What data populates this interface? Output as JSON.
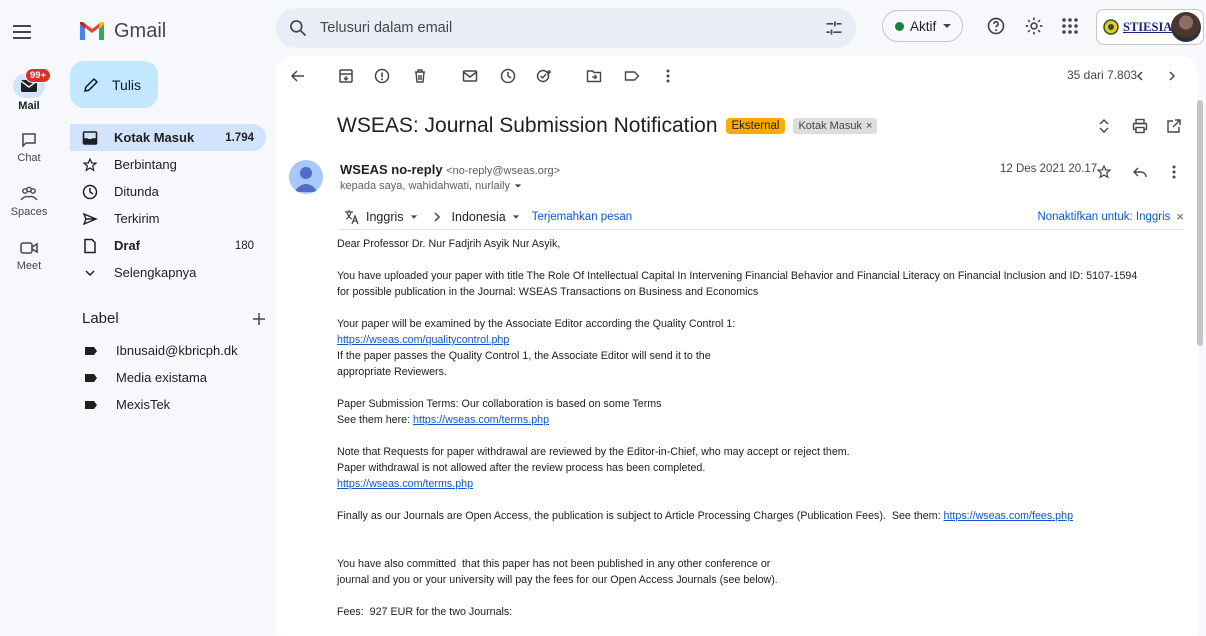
{
  "app": {
    "name": "Gmail"
  },
  "search": {
    "placeholder": "Telusuri dalam email"
  },
  "status": {
    "label": "Aktif"
  },
  "org": {
    "name": "STIESIA"
  },
  "rail": {
    "mail": {
      "label": "Mail",
      "badge": "99+"
    },
    "chat": {
      "label": "Chat"
    },
    "spaces": {
      "label": "Spaces"
    },
    "meet": {
      "label": "Meet"
    }
  },
  "compose": {
    "label": "Tulis"
  },
  "nav": {
    "items": [
      {
        "label": "Kotak Masuk",
        "count": "1.794"
      },
      {
        "label": "Berbintang",
        "count": ""
      },
      {
        "label": "Ditunda",
        "count": ""
      },
      {
        "label": "Terkirim",
        "count": ""
      },
      {
        "label": "Draf",
        "count": "180"
      },
      {
        "label": "Selengkapnya",
        "count": ""
      }
    ]
  },
  "labels": {
    "header": "Label",
    "items": [
      {
        "label": "Ibnusaid@kbricph.dk"
      },
      {
        "label": "Media existama"
      },
      {
        "label": "MexisTek"
      }
    ]
  },
  "toolbar": {
    "pager": "35 dari 7.803"
  },
  "email": {
    "subject": "WSEAS: Journal Submission Notification",
    "chip_external": "Eksternal",
    "chip_inbox": "Kotak Masuk",
    "chip_close": "×",
    "sender_name": "WSEAS no-reply",
    "sender_email": "<no-reply@wseas.org>",
    "to": "kepada saya, wahidahwati, nurlaily",
    "date": "12 Des 2021 20.17"
  },
  "translate": {
    "from": "Inggris",
    "to": "Indonesia",
    "action": "Terjemahkan pesan",
    "disable": "Nonaktifkan untuk: Inggris",
    "close": "×"
  },
  "body": {
    "greeting": "Dear Professor Dr. Nur Fadjrih Asyik Nur Asyik,",
    "p1": "You have uploaded your paper with title The Role Of Intellectual Capital In Intervening Financial Behavior and Financial Literacy on Financial Inclusion and ID: 5107-1594\nfor possible publication in the Journal: WSEAS Transactions on Business and Economics",
    "p2a": "Your paper will be examined by the Associate Editor according the Quality Control 1:",
    "p2_link": "https://wseas.com/qualitycontrol.php",
    "p2b": "If the paper passes the Quality Control 1, the Associate Editor will send it to the\nappropriate Reviewers.",
    "p3a": "Paper Submission Terms: Our collaboration is based on some Terms\nSee them here: ",
    "p3_link": "https://wseas.com/terms.php",
    "p4a": "Note that Requests for paper withdrawal are reviewed by the Editor-in-Chief, who may accept or reject them.\nPaper withdrawal is not allowed after the review process has been completed.",
    "p4_link": "https://wseas.com/terms.php",
    "p5a": "Finally as our Journals are Open Access, the publication is subject to Article Processing Charges (Publication Fees).  See them: ",
    "p5_link": "https://wseas.com/fees.php",
    "p6": "You have also committed  that this paper has not been published in any other conference or\njournal and you or your university will pay the fees for our Open Access Journals (see below).",
    "p7": "Fees:  927 EUR for the two Journals:"
  },
  "colors": {
    "accent": "#0b57d0",
    "compose_bg": "#c2e7ff",
    "active_nav": "#d3e3fd",
    "external_chip": "#f9ab00"
  }
}
